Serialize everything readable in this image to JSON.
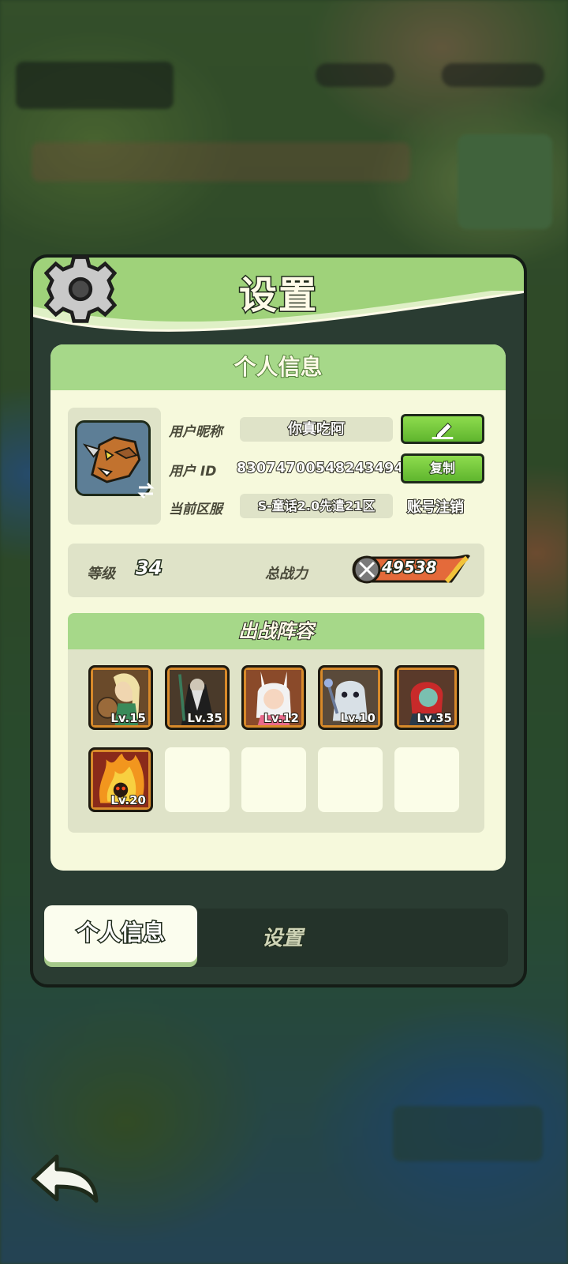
{
  "dialog": {
    "title": "设置",
    "card_title": "个人信息"
  },
  "profile": {
    "nickname_label": "用户昵称",
    "nickname": "你真吃阿",
    "id_label": "用户  ID",
    "user_id": "83074700548243494",
    "server_label": "当前区服",
    "server": "S-童话2.0先遣21区",
    "copy_button": "复制",
    "logout_link": "账号注销"
  },
  "stats": {
    "level_label": "等级",
    "level": "34",
    "power_label": "总战力",
    "power": "49538"
  },
  "lineup": {
    "title": "出战阵容",
    "heroes": [
      {
        "level": "Lv.15"
      },
      {
        "level": "Lv.35"
      },
      {
        "level": "Lv.12"
      },
      {
        "level": "Lv.10"
      },
      {
        "level": "Lv.35"
      },
      {
        "level": "Lv.20"
      }
    ]
  },
  "tabs": {
    "profile": "个人信息",
    "settings": "设置"
  },
  "icons": {
    "gear": "gear-icon",
    "edit": "pencil-icon",
    "swap": "swap-icon",
    "power": "crossed-swords-icon",
    "back": "back-arrow-icon"
  }
}
